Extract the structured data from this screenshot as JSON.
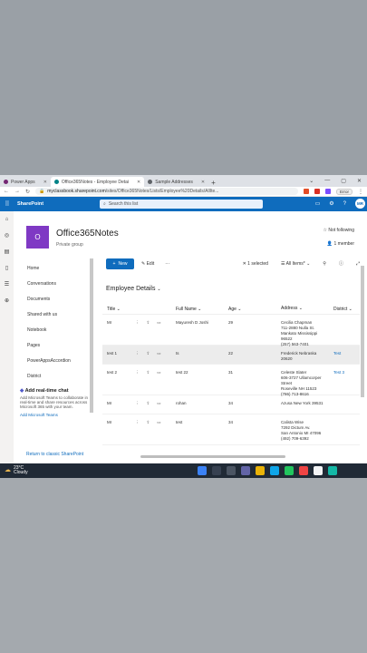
{
  "browser": {
    "tabs": [
      {
        "label": "Power Apps",
        "color": "#742774",
        "active": false
      },
      {
        "label": "Office365Notes - Employee Detai",
        "color": "#038387",
        "active": true
      },
      {
        "label": "Sample Addresses",
        "color": "#5f6368",
        "active": false
      }
    ],
    "url_host": "myclassbook.sharepoint.com",
    "url_path": "/sites/Office365Notes/Lists/Employee%20Details/AllIte...",
    "error_button": "Error"
  },
  "suitebar": {
    "app_name": "SharePoint",
    "search_placeholder": "Search this list",
    "avatar_initials": "MR"
  },
  "site": {
    "logo_letter": "O",
    "name": "Office365Notes",
    "subtitle": "Private group",
    "follow_label": "Not following",
    "members_label": "1 member"
  },
  "nav": {
    "items": [
      "Home",
      "Conversations",
      "Documents",
      "Shared with us",
      "Notebook",
      "Pages",
      "PowerAppsAccordion",
      "District"
    ],
    "teams_title": "Add real-time chat",
    "teams_text": "Add Microsoft Teams to collaborate in real-time and share resources across Microsoft 365 with your team.",
    "teams_link": "Add Microsoft Teams",
    "classic_link": "Return to classic SharePoint"
  },
  "commands": {
    "new_label": "New",
    "edit_label": "Edit",
    "more_label": "···",
    "selected_label": "1 selected",
    "view_label": "All Items*"
  },
  "list": {
    "view_title": "Employee Details",
    "columns": [
      "Title",
      "Full Name",
      "Age",
      "Address",
      "District"
    ],
    "rows": [
      {
        "title": "Mr",
        "name": "Mayuresh D Joshi",
        "age": "29",
        "address": "Cecilia Chapman\n711-2880 Nulla St.\nMankato Mississippi\n96522\n(257) 563-7401",
        "district": "",
        "selected": false,
        "tall": true
      },
      {
        "title": "test 1",
        "name": "ts",
        "age": "22",
        "address": "Frederick Nebraska\n20620",
        "district": "Test",
        "selected": true,
        "tall": false
      },
      {
        "title": "test 2",
        "name": "test 22",
        "age": "31",
        "address": "Celeste Slater\n606-3727 Ullamcorper\nStreet\nRoseville NH 11523\n(786) 713-8616",
        "district": "Test 3",
        "selected": false,
        "tall": true
      },
      {
        "title": "Mr",
        "name": "rohan",
        "age": "34",
        "address": "Azusa New York 39531",
        "district": "",
        "selected": false,
        "tall": false
      },
      {
        "title": "Mr",
        "name": "test",
        "age": "34",
        "address": "Calista Wise\n7292 Dictum Av.\nSan Antonio MI 47096\n(492) 709-6392",
        "district": "",
        "selected": false,
        "tall": true
      }
    ]
  },
  "taskbar": {
    "temp": "23°C",
    "condition": "Cloudy"
  }
}
